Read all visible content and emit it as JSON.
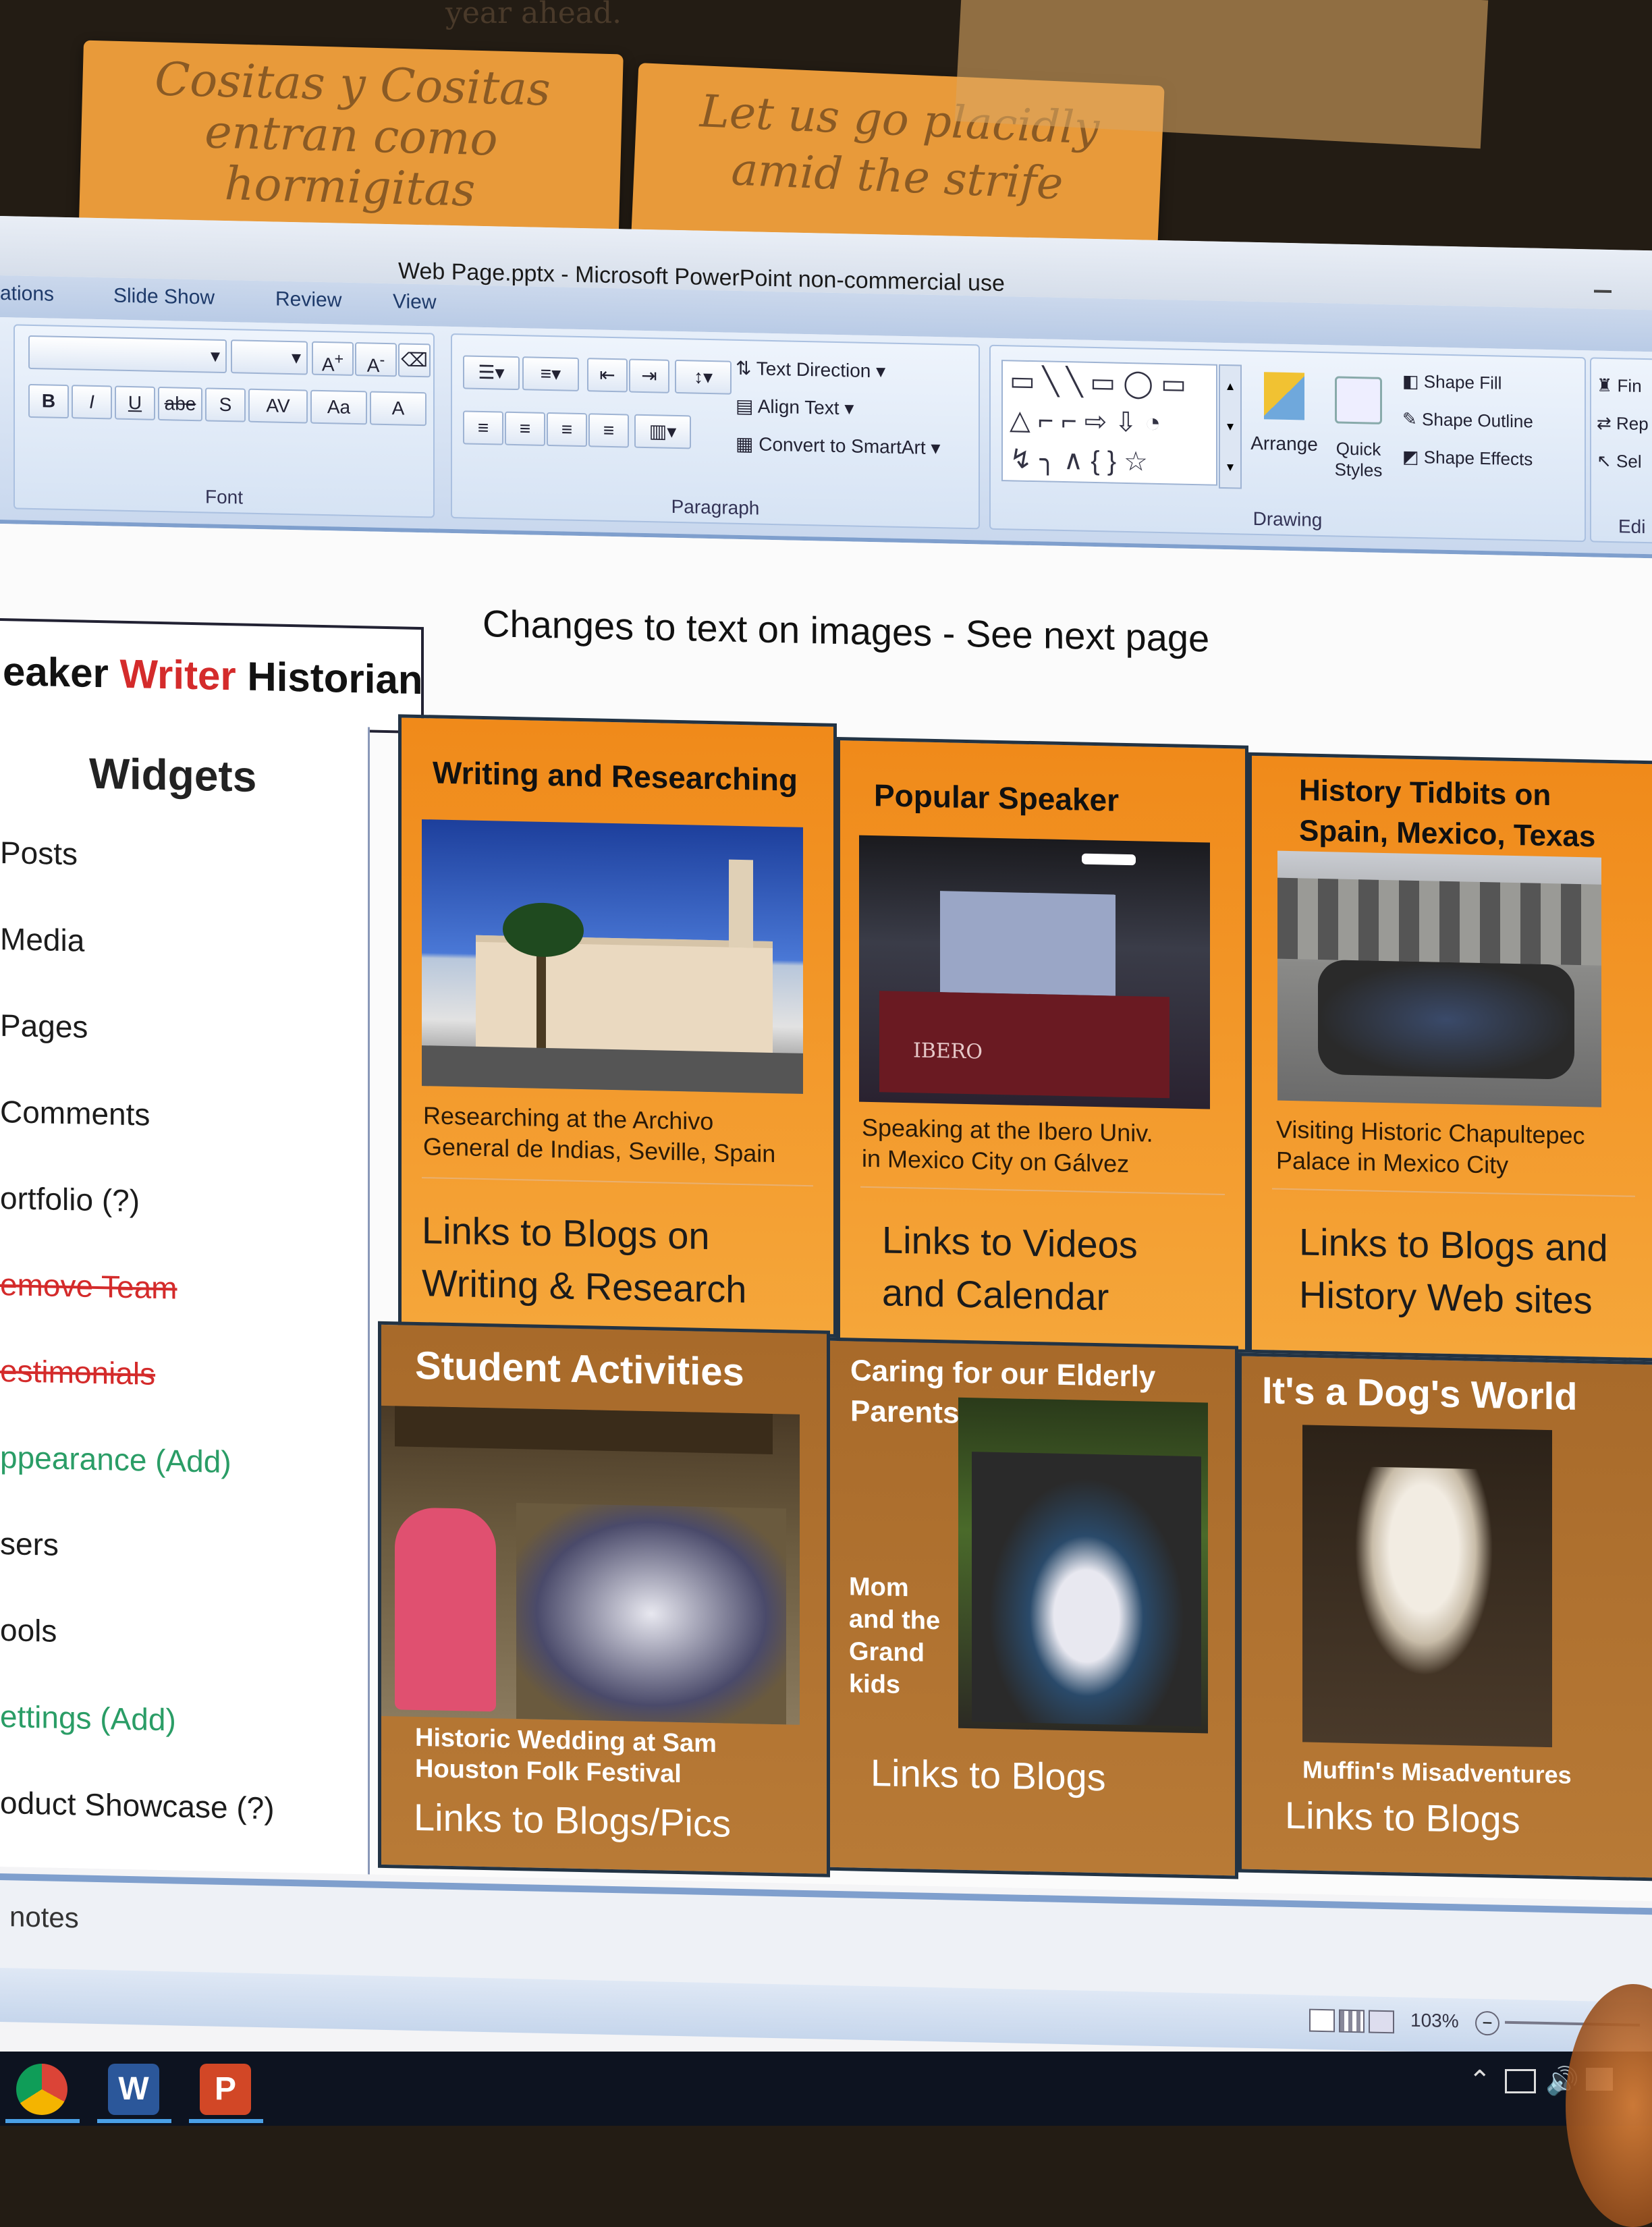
{
  "sticky_notes": [
    {
      "lines": [
        "Cositas y Cositas",
        "entran como",
        "hormigitas"
      ]
    },
    {
      "lines": [
        "Let us go placidly",
        "amid the strife"
      ]
    }
  ],
  "background_scribbles": [
    "year ahead."
  ],
  "window": {
    "title": "Web Page.pptx - Microsoft PowerPoint non-commercial use"
  },
  "ribbon_tabs": [
    "ations",
    "Slide Show",
    "Review",
    "View"
  ],
  "ribbon": {
    "font_group": {
      "label": "Font",
      "buttons": [
        "B",
        "I",
        "U",
        "abe",
        "S",
        "AV",
        "Aa",
        "A"
      ]
    },
    "paragraph_group": {
      "label": "Paragraph",
      "commands": [
        "Text Direction",
        "Align Text",
        "Convert to SmartArt"
      ]
    },
    "drawing_group": {
      "label": "Drawing",
      "commands": [
        "Arrange",
        "Quick Styles",
        "Shape Fill",
        "Shape Outline",
        "Shape Effects"
      ]
    },
    "editing_partial": [
      "Fin",
      "Rep",
      "Sel",
      "Edi"
    ]
  },
  "slide": {
    "headline": "Changes to text on images -  See next page",
    "brand": {
      "part1": "eaker ",
      "part2": "Writer",
      "part3": " Historian"
    }
  },
  "widgets": {
    "heading": "Widgets",
    "items": [
      {
        "label": "Posts",
        "style": "normal"
      },
      {
        "label": "Media",
        "style": "normal"
      },
      {
        "label": "Pages",
        "style": "normal"
      },
      {
        "label": "Comments",
        "style": "normal"
      },
      {
        "label": "ortfolio   (?)",
        "style": "normal"
      },
      {
        "label": "emove Team",
        "style": "strike"
      },
      {
        "label": "estimonials",
        "style": "strike"
      },
      {
        "label": "ppearance (Add)",
        "style": "green"
      },
      {
        "label": "sers",
        "style": "normal"
      },
      {
        "label": "ools",
        "style": "normal"
      },
      {
        "label": "ettings  (Add)",
        "style": "green"
      },
      {
        "label": "oduct Showcase  (?)",
        "style": "normal"
      }
    ]
  },
  "cards": [
    {
      "title": "Writing and Researching",
      "caption": [
        "Researching at the Archivo",
        "General de Indias, Seville, Spain"
      ],
      "link": [
        "Links to Blogs on",
        "Writing & Research"
      ]
    },
    {
      "title": "Popular Speaker",
      "caption": [
        "Speaking at the Ibero Univ.",
        "in Mexico City on Gálvez"
      ],
      "link": [
        "Links to Videos",
        "and Calendar"
      ]
    },
    {
      "title": [
        "History Tidbits on",
        "Spain, Mexico, Texas"
      ],
      "caption": [
        "Visiting Historic Chapultepec",
        "Palace in Mexico City"
      ],
      "link": [
        "Links to Blogs and",
        "History Web sites"
      ]
    },
    {
      "title": "Student Activities",
      "caption": [
        "Historic Wedding at Sam",
        "Houston Folk Festival"
      ],
      "link": "Links to Blogs/Pics"
    },
    {
      "title": [
        "Caring for our Elderly",
        "Parents"
      ],
      "side_caption": [
        "Mom",
        "and the",
        "Grand",
        "kids"
      ],
      "link": "Links to Blogs"
    },
    {
      "title": "It's a Dog's World",
      "caption": "Muffin's Misadventures",
      "link": "Links to Blogs"
    }
  ],
  "photo_signs": {
    "ibero": "IBERO"
  },
  "notes": {
    "label": "notes"
  },
  "status": {
    "zoom": "103%"
  },
  "taskbar": {
    "apps": [
      "chrome-icon",
      "word-icon",
      "powerpoint-icon"
    ]
  }
}
